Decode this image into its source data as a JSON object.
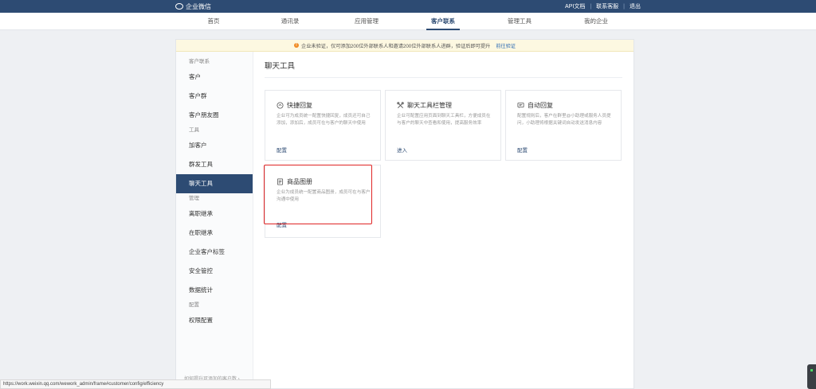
{
  "topbar": {
    "logo_text": "企业微信",
    "links": [
      "API文档",
      "联系客服",
      "退出"
    ]
  },
  "nav": {
    "tabs": [
      "首页",
      "通讯录",
      "应用管理",
      "客户联系",
      "管理工具",
      "我的企业"
    ],
    "active": "客户联系"
  },
  "notice": {
    "text": "企业未验证，仅可添加200位外部联系人和邀请200位外部联系人进群，验证后即可提升",
    "link": "前往验证"
  },
  "sidebar": {
    "group_customer": "客户联系",
    "customer_items": [
      "客户",
      "客户群",
      "客户朋友圈"
    ],
    "group_tools": "工具",
    "tool_items": [
      "加客户",
      "群发工具",
      "聊天工具"
    ],
    "group_manage": "管理",
    "manage_items": [
      "离职继承",
      "在职继承",
      "企业客户标签",
      "安全管控",
      "数据统计"
    ],
    "group_config": "配置",
    "config_items": [
      "权限配置"
    ],
    "footer": "如何提升可添加的客户数 ›"
  },
  "main": {
    "title": "聊天工具",
    "cards": [
      {
        "title": "快捷回复",
        "icon": "chat-bubble-icon",
        "desc": "企业可为成员统一配置快捷回复，成员还可自己添加，添加后，成员可在与客户的聊天中使用",
        "link": "配置"
      },
      {
        "title": "聊天工具栏管理",
        "icon": "tools-icon",
        "desc": "企业可配置应用页面到聊天工具栏，方便成员在与客户的聊天中查看和使用，提高服务效率",
        "link": "进入"
      },
      {
        "title": "自动回复",
        "icon": "auto-reply-icon",
        "desc": "配置规则后，客户在群里@小助理或服务人员提问，小助理将根据关键词自动发送消息内容",
        "link": "配置"
      },
      {
        "title": "商品图册",
        "icon": "catalog-icon",
        "desc": "企业为成员统一配置商品图册，成员可在与客户沟通中使用",
        "link": "配置"
      }
    ]
  },
  "statusbar": {
    "url": "https://work.weixin.qq.com/wework_admin/frame#customer/config/efficiency"
  },
  "colors": {
    "brand": "#2d4b73",
    "notice_bg": "#fdf8e1",
    "highlight": "#e02424"
  }
}
